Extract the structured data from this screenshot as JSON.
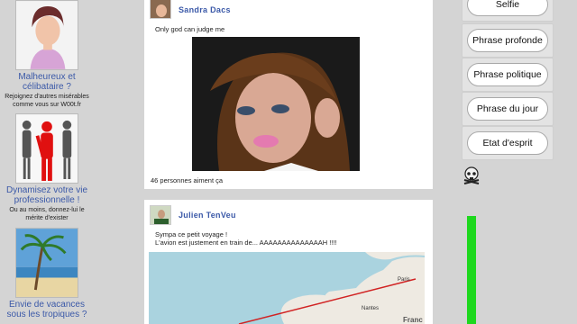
{
  "ads": [
    {
      "title": "Malheureux et célibataire ?",
      "subtitle": "Rejoignez d'autres misérables comme vous sur W00t.fr",
      "icon": "portrait-woman-icon"
    },
    {
      "title": "Dynamisez votre vie professionnelle !",
      "subtitle": "Ou au moins, donnez-lui le mérite d'exister",
      "icon": "business-people-icon"
    },
    {
      "title": "Envie de vacances sous les tropiques ?",
      "subtitle": "",
      "icon": "palm-beach-icon"
    }
  ],
  "posts": [
    {
      "author": "Sandra Dacs",
      "text": "Only god can judge me",
      "likes": "46 personnes aiment ça"
    },
    {
      "author": "Julien TenVeu",
      "line1": "Sympa ce petit voyage !",
      "line2": "L'avion est justement en train de... AAAAAAAAAAAAAAH !!!!"
    }
  ],
  "map_labels": {
    "paris": "Paris",
    "nantes": "Nantes",
    "france": "Franc"
  },
  "buttons": [
    "Selfie",
    "Phrase profonde",
    "Phrase politique",
    "Phrase du jour",
    "Etat d'esprit"
  ],
  "colors": {
    "link": "#3b59a8",
    "meter": "#1ed81e",
    "background": "#d4d4d4"
  }
}
